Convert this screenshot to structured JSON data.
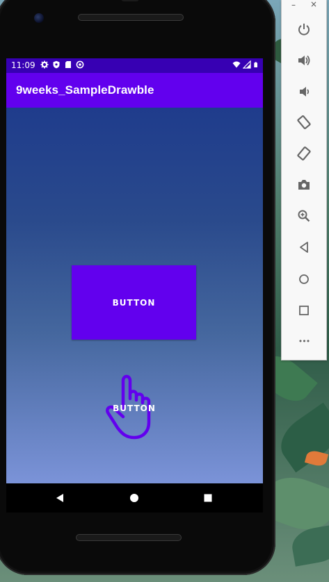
{
  "status_bar": {
    "time": "11:09",
    "left_icons": [
      "settings-icon",
      "shield-icon",
      "sd-card-icon",
      "sync-icon"
    ],
    "right_icons": [
      "wifi-icon",
      "signal-icon",
      "battery-icon"
    ]
  },
  "app_bar": {
    "title": "9weeks_SampleDrawble"
  },
  "main": {
    "button_primary_label": "BUTTON",
    "button_secondary_label": "BUTTON"
  },
  "nav": {
    "back": "back-icon",
    "home": "home-icon",
    "recents": "recents-icon"
  },
  "toolbar": {
    "minimize_label": "–",
    "close_label": "×",
    "items": [
      "power-icon",
      "volume-up-icon",
      "volume-down-icon",
      "rotate-left-icon",
      "rotate-right-icon",
      "camera-icon",
      "zoom-icon",
      "back-icon",
      "home-icon",
      "overview-icon",
      "more-icon"
    ],
    "more_label": "•••"
  },
  "colors": {
    "status_bar": "#3700b3",
    "app_bar": "#6200ee",
    "accent": "#6200ee",
    "gradient_top": "#1f3c8c",
    "gradient_bottom": "#7b93d8"
  }
}
